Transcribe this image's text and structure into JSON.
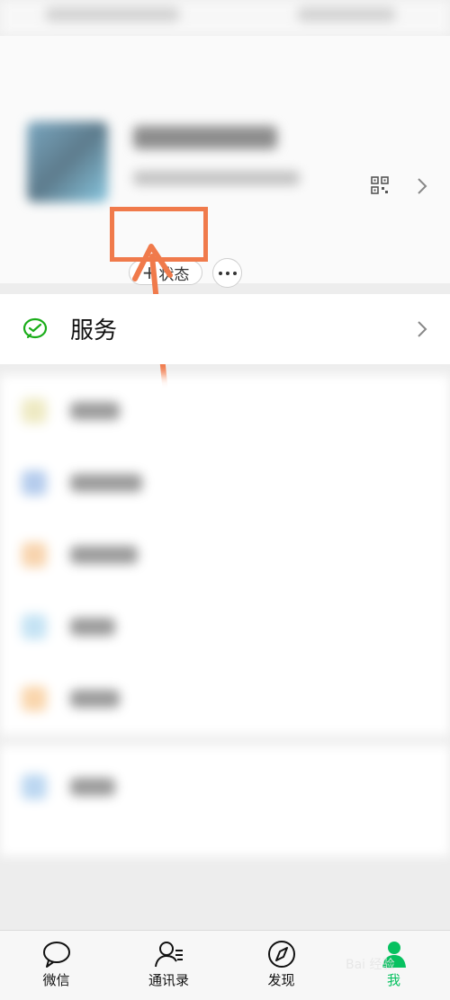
{
  "profile": {
    "status_button_label": "状态",
    "qr_icon": "qr-code-icon",
    "chevron_icon": "chevron-right-icon"
  },
  "services": {
    "label": "服务",
    "icon": "wechat-pay-icon",
    "icon_color": "#1aad19"
  },
  "tabs": [
    {
      "label": "微信",
      "icon": "chat-bubble-icon",
      "active": false
    },
    {
      "label": "通讯录",
      "icon": "contacts-icon",
      "active": false
    },
    {
      "label": "发现",
      "icon": "compass-icon",
      "active": false
    },
    {
      "label": "我",
      "icon": "person-icon",
      "active": true
    }
  ],
  "overlay": {
    "highlight_color": "#f07a4b",
    "watermark": "Bai 经验"
  },
  "colors": {
    "active_tab": "#07c160"
  }
}
